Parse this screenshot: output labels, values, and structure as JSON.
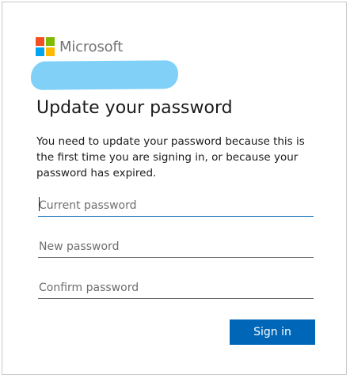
{
  "brand": {
    "name": "Microsoft",
    "logo_colors": [
      "#f25022",
      "#7fba00",
      "#00a4ef",
      "#ffb900"
    ],
    "redaction_color": "#80d0f7"
  },
  "title": "Update your password",
  "description": "You need to update your password because this is the first time you are signing in, or because your password has expired.",
  "fields": {
    "current_password": {
      "placeholder": "Current password",
      "value": ""
    },
    "new_password": {
      "placeholder": "New password",
      "value": ""
    },
    "confirm_password": {
      "placeholder": "Confirm password",
      "value": ""
    }
  },
  "buttons": {
    "sign_in_label": "Sign in"
  },
  "colors": {
    "accent": "#0067b8",
    "text": "#1b1b1b",
    "logo_text": "#737373"
  }
}
